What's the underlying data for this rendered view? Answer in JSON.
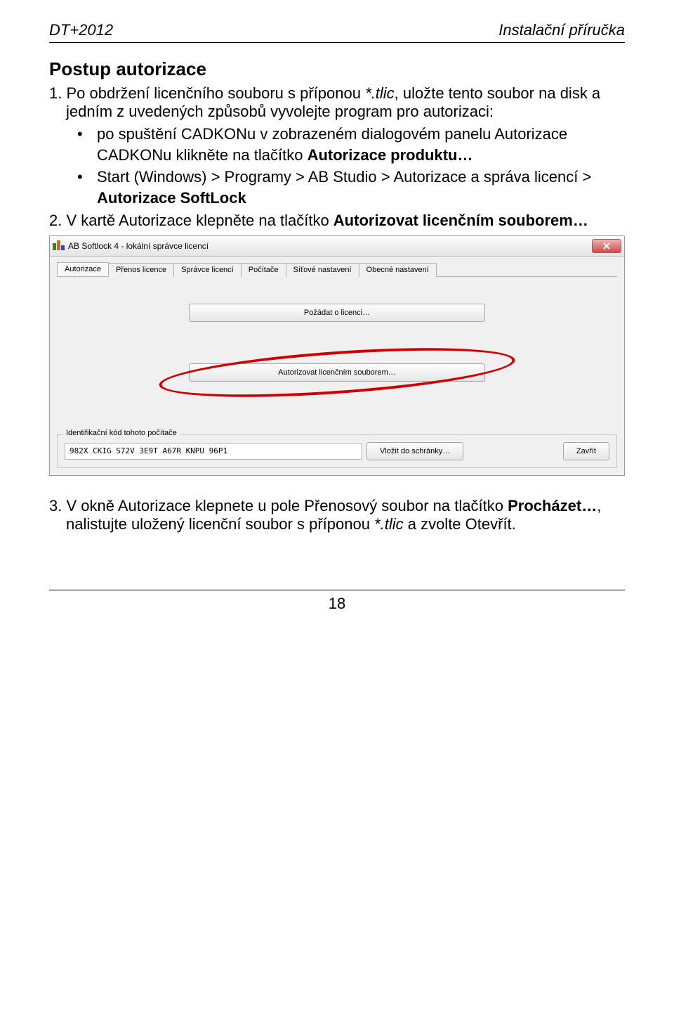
{
  "header": {
    "left": "DT+2012",
    "right": "Instalační příručka"
  },
  "title": "Postup autorizace",
  "step1": {
    "prefix": "1.   Po obdržení licenčního souboru s příponou ",
    "italic": "*.tlic",
    "cont": ", uložte tento soubor na disk a jedním z uvedených způsobů vyvolejte program pro autorizaci:"
  },
  "bullets": {
    "b1_a": "po spuštění CADKONu v zobrazeném dialogovém panelu Autorizace CADKONu klikněte na tlačítko ",
    "b1_b": "Autorizace produktu…",
    "b2_a": "Start (Windows) > Programy > AB Studio > Autorizace a správa licencí > ",
    "b2_b": "Autorizace SoftLock"
  },
  "step2": {
    "prefix": "2.   V kartě Autorizace klepněte na tlačítko ",
    "bold": "Autorizovat licenčním souborem…"
  },
  "dlg": {
    "title": "AB Softlock 4  -  lokální správce licencí",
    "tabs": [
      "Autorizace",
      "Přenos licence",
      "Správce licencí",
      "Počítače",
      "Síťové nastavení",
      "Obecné nastavení"
    ],
    "btn_request": "Požádat o licenci…",
    "btn_authorize": "Autorizovat licenčním souborem…",
    "group_legend": "Identifikační kód tohoto počítače",
    "code": "982X CKIG S72V 3E9T A67R KNPU 96P1",
    "btn_clipboard": "Vložit do schránky…",
    "btn_close": "Zavřít"
  },
  "step3": {
    "prefix": "3.   V okně Autorizace klepnete u pole Přenosový soubor na tlačítko ",
    "b1": "Procházet…",
    "mid": ", nalistujte uložený licenční soubor s příponou ",
    "italic": "*.tlic",
    "tail": " a zvolte Otevřít."
  },
  "pagenum": "18"
}
